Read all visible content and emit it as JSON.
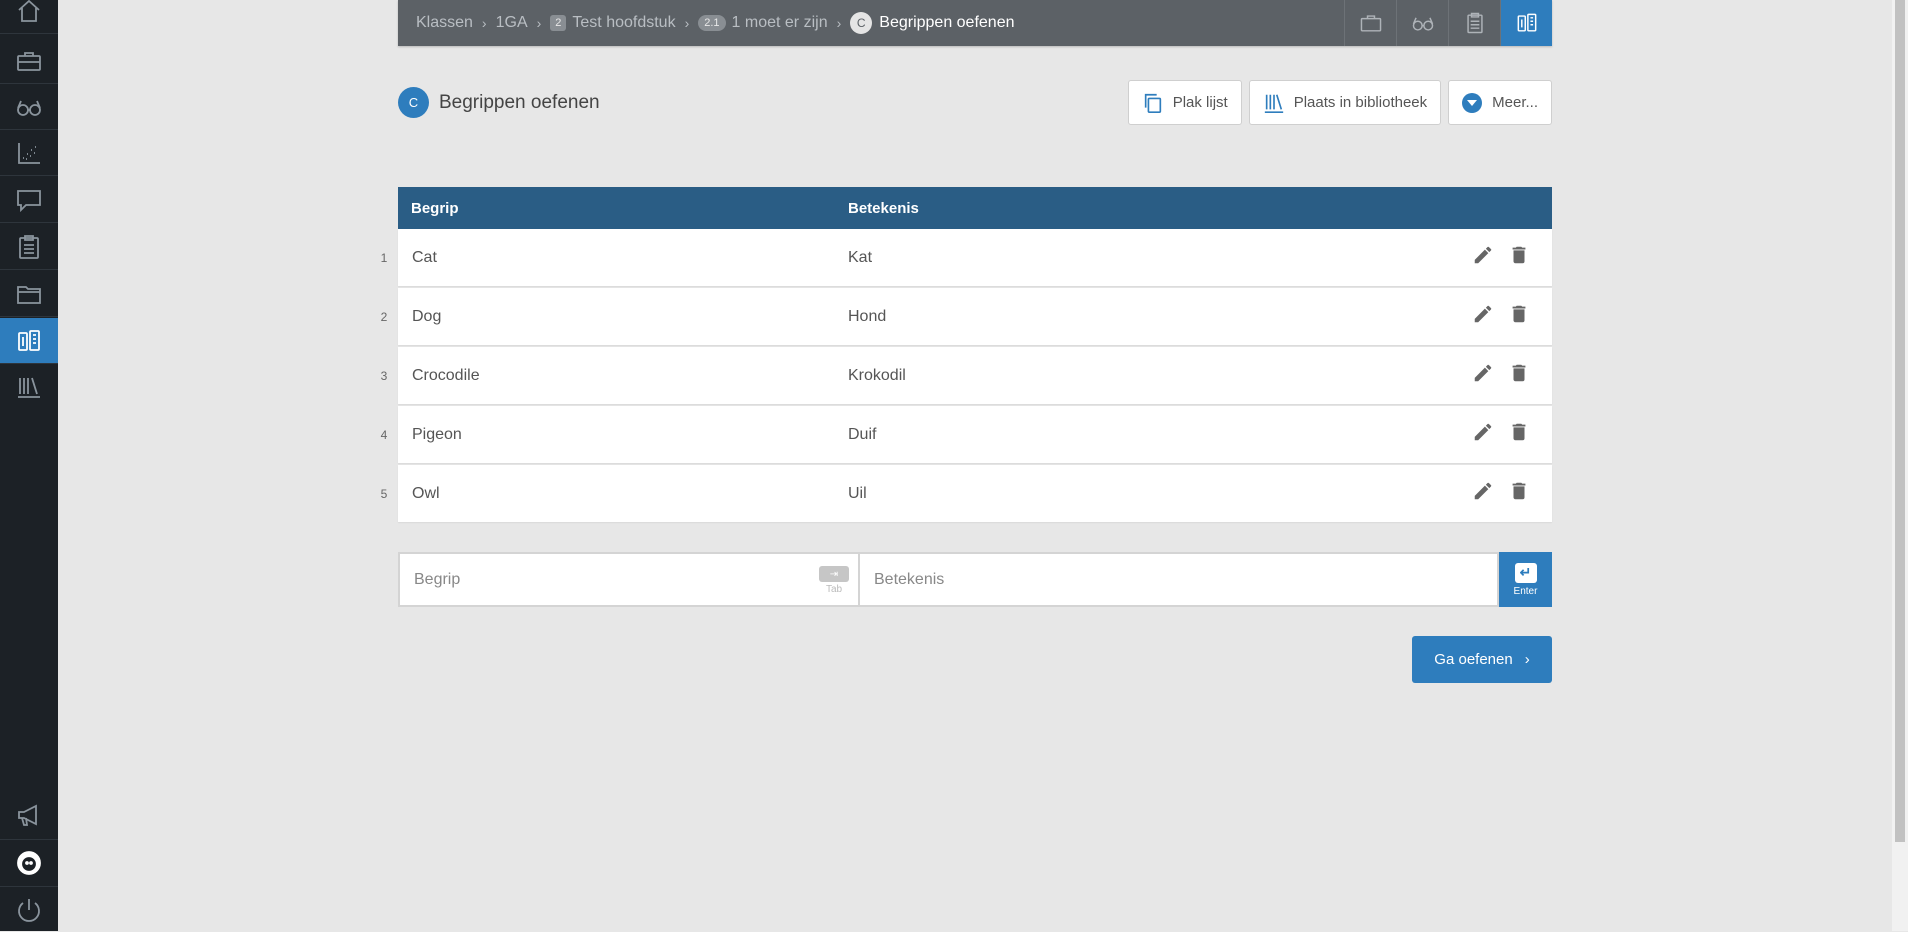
{
  "breadcrumb": [
    {
      "label": "Klassen",
      "badge": ""
    },
    {
      "label": "1GA",
      "badge": ""
    },
    {
      "label": "Test hoofdstuk",
      "badge": "2"
    },
    {
      "label": "1 moet er zijn",
      "badge": "2.1"
    }
  ],
  "breadcrumb_current": {
    "label": "Begrippen oefenen",
    "badge": "C"
  },
  "page": {
    "badge": "C",
    "title": "Begrippen oefenen"
  },
  "actions": {
    "paste_list": "Plak lijst",
    "library": "Plaats in bibliotheek",
    "more": "Meer..."
  },
  "table": {
    "headers": [
      "Begrip",
      "Betekenis"
    ],
    "rows": [
      {
        "num": "1",
        "term": "Cat",
        "meaning": "Kat"
      },
      {
        "num": "2",
        "term": "Dog",
        "meaning": "Hond"
      },
      {
        "num": "3",
        "term": "Crocodile",
        "meaning": "Krokodil"
      },
      {
        "num": "4",
        "term": "Pigeon",
        "meaning": "Duif"
      },
      {
        "num": "5",
        "term": "Owl",
        "meaning": "Uil"
      }
    ]
  },
  "entry": {
    "term_placeholder": "Begrip",
    "meaning_placeholder": "Betekenis",
    "tab_key_symbol": "⇥",
    "tab_label": "Tab",
    "enter_key_symbol": "↵",
    "enter_label": "Enter"
  },
  "go_button": {
    "label": "Ga oefenen",
    "chevron": "›"
  },
  "colors": {
    "accent": "#2e7dbd",
    "header": "#2a5d85",
    "sidebar": "#1c2126",
    "topbar": "#5c6166"
  },
  "sidebar_icons": [
    "home-icon",
    "briefcase-icon",
    "glasses-icon",
    "chart-icon",
    "chat-icon",
    "clipboard-icon",
    "folder-icon",
    "flashcards-icon",
    "library-icon",
    "megaphone-icon",
    "avatar-icon",
    "power-icon"
  ]
}
